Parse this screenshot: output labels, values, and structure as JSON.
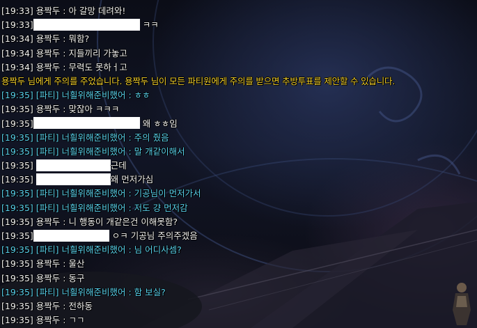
{
  "chat": {
    "lines": [
      {
        "time": "[19:33]",
        "sender": "용짝두",
        "sep": " : ",
        "text": "아 갈망 데려와!"
      },
      {
        "time": "[19:33]",
        "text": "ㅋㅋ"
      },
      {
        "time": "[19:34]",
        "sender": "용짝두",
        "sep": " : ",
        "text": "뭐함?"
      },
      {
        "time": "[19:34]",
        "sender": "용짝두",
        "sep": " : ",
        "text": "지들끼리 가놓고"
      },
      {
        "time": "[19:34]",
        "sender": "용짝두",
        "sep": " : ",
        "text": "무력도 못하ㅓ고"
      },
      {
        "text": "용짝두 님에게 주의를 주었습니다. 용짝두 님이 모든 파티원에게 주의를 받으면 추방투표를 제안할 수 있습니다."
      },
      {
        "time": "[19:35]",
        "sender": "[파티] 너흴위해준비했어",
        "sep": " : ",
        "text": "ㅎㅎ"
      },
      {
        "time": "[19:35]",
        "sender": "용짝두",
        "sep": " : ",
        "text": "맞잖아 ㅋㅋㅋ"
      },
      {
        "time": "[19:35]",
        "text": "왜 ㅎㅎ임"
      },
      {
        "time": "[19:35]",
        "sender": "[파티] 너흴위해준비했어",
        "sep": " : ",
        "text": "주의 줬음"
      },
      {
        "time": "[19:35]",
        "sender": "[파티] 너흴위해준비했어",
        "sep": " : ",
        "text": "말 개같이해서"
      },
      {
        "time": "[19:35]",
        "text": "근데"
      },
      {
        "time": "[19:35]",
        "text": "왜 먼저가심"
      },
      {
        "time": "[19:35]",
        "sender": "[파티] 너흴위해준비했어",
        "sep": " : ",
        "text": "기공님이 먼저가서"
      },
      {
        "time": "[19:35]",
        "sender": "[파티] 너흴위해준비했어",
        "sep": " : ",
        "text": "저도 걍 먼저감"
      },
      {
        "time": "[19:35]",
        "sender": "용짝두",
        "sep": " : ",
        "text": "니 행동이 개같은건 이해못함?"
      },
      {
        "time": "[19:35]",
        "text": "ㅇㅋ 기공님 주의주겠음"
      },
      {
        "time": "[19:35]",
        "sender": "[파티] 너흴위해준비했어",
        "sep": " : ",
        "text": "님 어디사셈?"
      },
      {
        "time": "[19:35]",
        "sender": "용짝두",
        "sep": " : ",
        "text": "울산"
      },
      {
        "time": "[19:35]",
        "sender": "용짝두",
        "sep": " : ",
        "text": "동구"
      },
      {
        "time": "[19:35]",
        "sender": "[파티] 너흴위해준비했어",
        "sep": " : ",
        "text": "함 보실?"
      },
      {
        "time": "[19:35]",
        "sender": "용짝두",
        "sep": " : ",
        "text": "전하동"
      },
      {
        "time": "[19:35]",
        "sender": "용짝두",
        "sep": " : ",
        "text": "ㄱㄱ"
      }
    ]
  },
  "colors": {
    "normal_text": "#f2f2f2",
    "party_text": "#5ad2ee",
    "system_text": "#f2cf2c",
    "redaction": "#ffffff"
  }
}
